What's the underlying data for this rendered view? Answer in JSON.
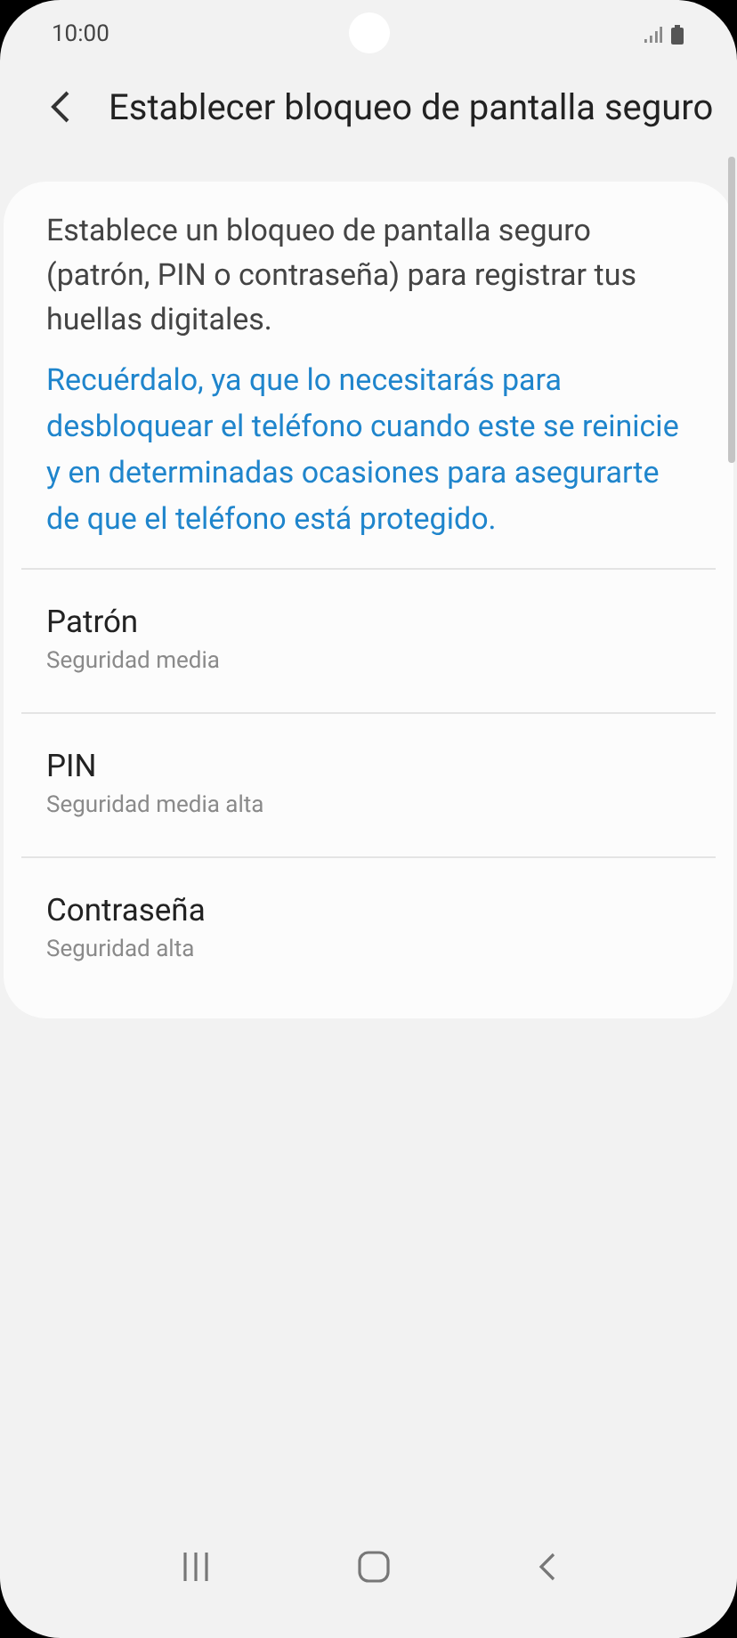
{
  "status_bar": {
    "time": "10:00"
  },
  "header": {
    "title": "Establecer bloqueo de pantalla seguro"
  },
  "card": {
    "description": "Establece un bloqueo de pantalla seguro (patrón, PIN o contraseña) para registrar tus huellas digitales.",
    "note": "Recuérdalo, ya que lo necesitarás para desbloquear el teléfono cuando este se reinicie y en determinadas ocasiones para asegurarte de que el teléfono está protegido.",
    "options": [
      {
        "title": "Patrón",
        "subtitle": "Seguridad media"
      },
      {
        "title": "PIN",
        "subtitle": "Seguridad media alta"
      },
      {
        "title": "Contraseña",
        "subtitle": "Seguridad alta"
      }
    ]
  }
}
